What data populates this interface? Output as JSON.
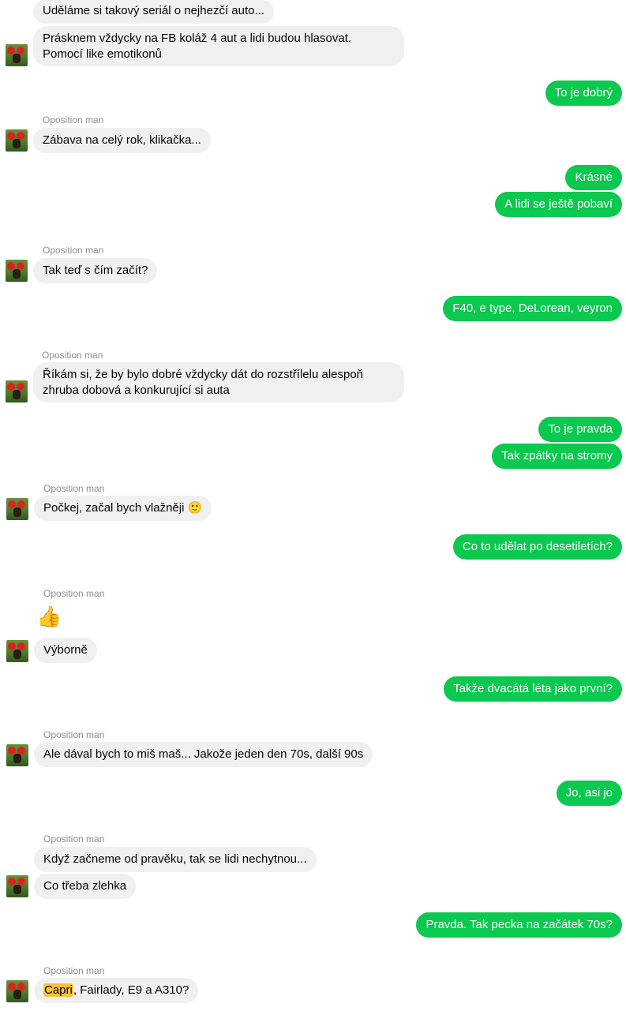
{
  "messages": [
    {
      "from": "them",
      "text": "Uděláme si takový seriál o nejhezčí auto..."
    },
    {
      "from": "them",
      "text": "Prásknem vždycky na FB koláž 4 aut a lidi budou hlasovat. Pomocí like emotikonů"
    },
    {
      "from": "me",
      "text": "To je dobrý"
    },
    {
      "from": "them",
      "sender": "Oposition man",
      "text": "Zábava na celý rok, klikačka..."
    },
    {
      "from": "me",
      "text": "Krásné"
    },
    {
      "from": "me",
      "text": "A lidi se ještě pobaví"
    },
    {
      "from": "them",
      "sender": "Oposition man",
      "text": "Tak teď s čím začít?"
    },
    {
      "from": "me",
      "text": "F40, e type, DeLorean, veyron"
    },
    {
      "from": "them",
      "sender": "Oposition man",
      "text": "Říkám si, že by bylo dobré vždycky dát do rozstřílelu alespoň zhruba dobová a konkurující si auta"
    },
    {
      "from": "me",
      "text": "To je pravda"
    },
    {
      "from": "me",
      "text": "Tak zpátky na stromy"
    },
    {
      "from": "them",
      "sender": "Oposition man",
      "text": "Počkej, začal bych vlažněji",
      "emoji": "🙂"
    },
    {
      "from": "me",
      "text": "Co to udělat po desetiletích?"
    },
    {
      "from": "them",
      "sender": "Oposition man",
      "emoji_only": "👍"
    },
    {
      "from": "them",
      "text": "Výborně"
    },
    {
      "from": "me",
      "text": "Takže dvacátá léta jako první?"
    },
    {
      "from": "them",
      "sender": "Oposition man",
      "text": "Ale dával bych to miš maš... Jakože jeden den 70s, další 90s"
    },
    {
      "from": "me",
      "text": "Jo, asi jo"
    },
    {
      "from": "them",
      "sender": "Oposition man",
      "text": "Když začneme od pravěku, tak se lidi nechytnou..."
    },
    {
      "from": "them",
      "text": "Co třeba zlehka"
    },
    {
      "from": "me",
      "text": "Pravda. Tak pecka na začátek 70s?"
    },
    {
      "from": "them",
      "sender": "Oposition man",
      "highlight": "Capri",
      "text": ", Fairlady, E9 a A310?"
    }
  ],
  "colors": {
    "incoming_bubble": "#f0f0f0",
    "outgoing_bubble": "#0bc84f",
    "highlight": "#f7c23a",
    "sender_name": "#8a8d91"
  },
  "icons": {
    "avatar": "ladybug-avatar",
    "thumbs_up": "thumbs-up-emoji",
    "smile": "smile-emoji"
  }
}
